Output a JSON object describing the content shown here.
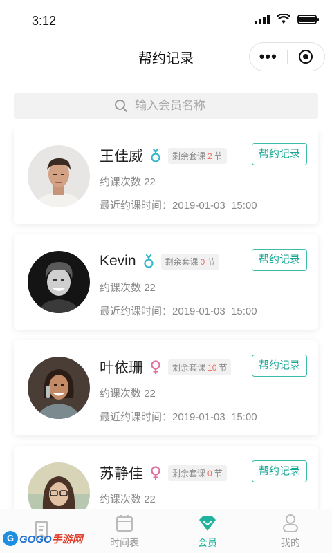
{
  "status": {
    "time": "3:12"
  },
  "nav": {
    "title": "帮约记录",
    "more": "•••"
  },
  "search": {
    "placeholder": "输入会员名称"
  },
  "labels": {
    "remaining_prefix": "剩余套课",
    "remaining_unit": "节",
    "bookings_prefix": "约课次数",
    "last_booking_prefix": "最近约课时间：",
    "help_button": "帮约记录"
  },
  "members": [
    {
      "name": "王佳威",
      "gender": "male",
      "remaining": "2",
      "bookings": "22",
      "last_booking": "2019-01-03  15:00"
    },
    {
      "name": "Kevin",
      "gender": "male",
      "remaining": "0",
      "bookings": "22",
      "last_booking": "2019-01-03  15:00"
    },
    {
      "name": "叶依珊",
      "gender": "female",
      "remaining": "10",
      "bookings": "22",
      "last_booking": "2019-01-03  15:00"
    },
    {
      "name": "苏静佳",
      "gender": "female",
      "remaining": "0",
      "bookings": "22",
      "last_booking": ""
    }
  ],
  "tabs": [
    {
      "label": "",
      "icon": "document-icon"
    },
    {
      "label": "时间表",
      "icon": "calendar-icon"
    },
    {
      "label": "会员",
      "icon": "member-diamond-icon",
      "active": true
    },
    {
      "label": "我的",
      "icon": "profile-icon"
    }
  ],
  "watermark": {
    "part1": "GOGO",
    "part2": "手游网"
  },
  "colors": {
    "accent": "#1fb29e",
    "highlight_number": "#f06a5f",
    "male": "#35b9c9",
    "female": "#e0709e"
  }
}
